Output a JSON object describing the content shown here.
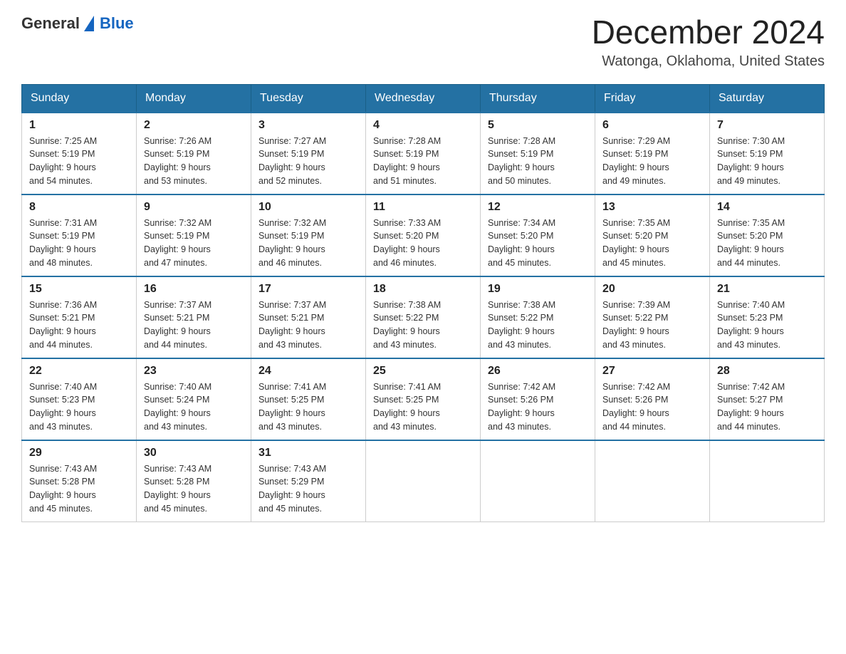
{
  "header": {
    "logo_general": "General",
    "logo_blue": "Blue",
    "month": "December 2024",
    "location": "Watonga, Oklahoma, United States"
  },
  "days_of_week": [
    "Sunday",
    "Monday",
    "Tuesday",
    "Wednesday",
    "Thursday",
    "Friday",
    "Saturday"
  ],
  "weeks": [
    [
      {
        "day": "1",
        "sunrise": "7:25 AM",
        "sunset": "5:19 PM",
        "daylight": "9 hours and 54 minutes."
      },
      {
        "day": "2",
        "sunrise": "7:26 AM",
        "sunset": "5:19 PM",
        "daylight": "9 hours and 53 minutes."
      },
      {
        "day": "3",
        "sunrise": "7:27 AM",
        "sunset": "5:19 PM",
        "daylight": "9 hours and 52 minutes."
      },
      {
        "day": "4",
        "sunrise": "7:28 AM",
        "sunset": "5:19 PM",
        "daylight": "9 hours and 51 minutes."
      },
      {
        "day": "5",
        "sunrise": "7:28 AM",
        "sunset": "5:19 PM",
        "daylight": "9 hours and 50 minutes."
      },
      {
        "day": "6",
        "sunrise": "7:29 AM",
        "sunset": "5:19 PM",
        "daylight": "9 hours and 49 minutes."
      },
      {
        "day": "7",
        "sunrise": "7:30 AM",
        "sunset": "5:19 PM",
        "daylight": "9 hours and 49 minutes."
      }
    ],
    [
      {
        "day": "8",
        "sunrise": "7:31 AM",
        "sunset": "5:19 PM",
        "daylight": "9 hours and 48 minutes."
      },
      {
        "day": "9",
        "sunrise": "7:32 AM",
        "sunset": "5:19 PM",
        "daylight": "9 hours and 47 minutes."
      },
      {
        "day": "10",
        "sunrise": "7:32 AM",
        "sunset": "5:19 PM",
        "daylight": "9 hours and 46 minutes."
      },
      {
        "day": "11",
        "sunrise": "7:33 AM",
        "sunset": "5:20 PM",
        "daylight": "9 hours and 46 minutes."
      },
      {
        "day": "12",
        "sunrise": "7:34 AM",
        "sunset": "5:20 PM",
        "daylight": "9 hours and 45 minutes."
      },
      {
        "day": "13",
        "sunrise": "7:35 AM",
        "sunset": "5:20 PM",
        "daylight": "9 hours and 45 minutes."
      },
      {
        "day": "14",
        "sunrise": "7:35 AM",
        "sunset": "5:20 PM",
        "daylight": "9 hours and 44 minutes."
      }
    ],
    [
      {
        "day": "15",
        "sunrise": "7:36 AM",
        "sunset": "5:21 PM",
        "daylight": "9 hours and 44 minutes."
      },
      {
        "day": "16",
        "sunrise": "7:37 AM",
        "sunset": "5:21 PM",
        "daylight": "9 hours and 44 minutes."
      },
      {
        "day": "17",
        "sunrise": "7:37 AM",
        "sunset": "5:21 PM",
        "daylight": "9 hours and 43 minutes."
      },
      {
        "day": "18",
        "sunrise": "7:38 AM",
        "sunset": "5:22 PM",
        "daylight": "9 hours and 43 minutes."
      },
      {
        "day": "19",
        "sunrise": "7:38 AM",
        "sunset": "5:22 PM",
        "daylight": "9 hours and 43 minutes."
      },
      {
        "day": "20",
        "sunrise": "7:39 AM",
        "sunset": "5:22 PM",
        "daylight": "9 hours and 43 minutes."
      },
      {
        "day": "21",
        "sunrise": "7:40 AM",
        "sunset": "5:23 PM",
        "daylight": "9 hours and 43 minutes."
      }
    ],
    [
      {
        "day": "22",
        "sunrise": "7:40 AM",
        "sunset": "5:23 PM",
        "daylight": "9 hours and 43 minutes."
      },
      {
        "day": "23",
        "sunrise": "7:40 AM",
        "sunset": "5:24 PM",
        "daylight": "9 hours and 43 minutes."
      },
      {
        "day": "24",
        "sunrise": "7:41 AM",
        "sunset": "5:25 PM",
        "daylight": "9 hours and 43 minutes."
      },
      {
        "day": "25",
        "sunrise": "7:41 AM",
        "sunset": "5:25 PM",
        "daylight": "9 hours and 43 minutes."
      },
      {
        "day": "26",
        "sunrise": "7:42 AM",
        "sunset": "5:26 PM",
        "daylight": "9 hours and 43 minutes."
      },
      {
        "day": "27",
        "sunrise": "7:42 AM",
        "sunset": "5:26 PM",
        "daylight": "9 hours and 44 minutes."
      },
      {
        "day": "28",
        "sunrise": "7:42 AM",
        "sunset": "5:27 PM",
        "daylight": "9 hours and 44 minutes."
      }
    ],
    [
      {
        "day": "29",
        "sunrise": "7:43 AM",
        "sunset": "5:28 PM",
        "daylight": "9 hours and 45 minutes."
      },
      {
        "day": "30",
        "sunrise": "7:43 AM",
        "sunset": "5:28 PM",
        "daylight": "9 hours and 45 minutes."
      },
      {
        "day": "31",
        "sunrise": "7:43 AM",
        "sunset": "5:29 PM",
        "daylight": "9 hours and 45 minutes."
      },
      null,
      null,
      null,
      null
    ]
  ],
  "labels": {
    "sunrise": "Sunrise:",
    "sunset": "Sunset:",
    "daylight": "Daylight:"
  }
}
